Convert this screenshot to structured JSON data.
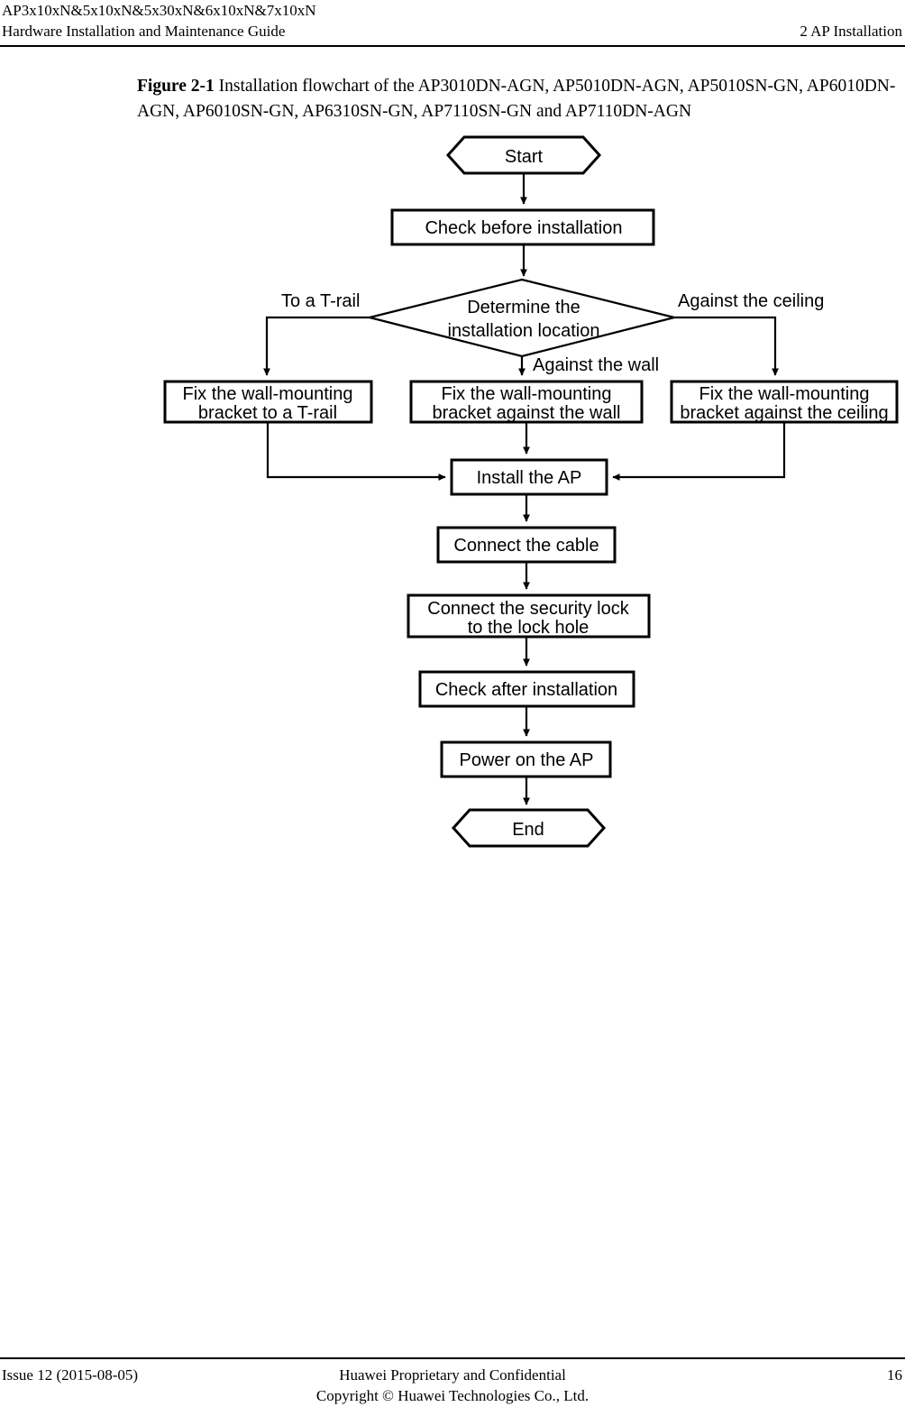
{
  "header": {
    "line1": "AP3x10xN&5x10xN&5x30xN&6x10xN&7x10xN",
    "line2_left": "Hardware Installation and Maintenance Guide",
    "line2_right": "2 AP Installation"
  },
  "figure": {
    "label": "Figure 2-1",
    "caption": " Installation flowchart of the AP3010DN-AGN, AP5010DN-AGN, AP5010SN-GN, AP6010DN-AGN, AP6010SN-GN, AP6310SN-GN, AP7110SN-GN and AP7110DN-AGN"
  },
  "flowchart": {
    "nodes": {
      "start": "Start",
      "check_before": "Check before installation",
      "decision_line1": "Determine the",
      "decision_line2": "installation location",
      "fix_trail_line1": "Fix the wall-mounting",
      "fix_trail_line2": "bracket to a T-rail",
      "fix_wall_line1": "Fix the wall-mounting",
      "fix_wall_line2": "bracket against the wall",
      "fix_ceiling_line1": "Fix the wall-mounting",
      "fix_ceiling_line2": "bracket against the ceiling",
      "install_ap": "Install the AP",
      "connect_cable": "Connect the cable",
      "security_lock_line1": "Connect the security lock",
      "security_lock_line2": "to the lock hole",
      "check_after": "Check after installation",
      "power_on": "Power on the AP",
      "end": "End"
    },
    "edge_labels": {
      "to_t_rail": "To  a T-rail",
      "against_ceiling": "Against the ceiling",
      "against_wall": "Against the wall"
    },
    "colors": {
      "stroke": "#000000",
      "fill": "#ffffff"
    }
  },
  "footer": {
    "left": "Issue 12 (2015-08-05)",
    "center_line1": "Huawei Proprietary and Confidential",
    "center_line2": "Copyright © Huawei Technologies Co., Ltd.",
    "page_number": "16"
  }
}
